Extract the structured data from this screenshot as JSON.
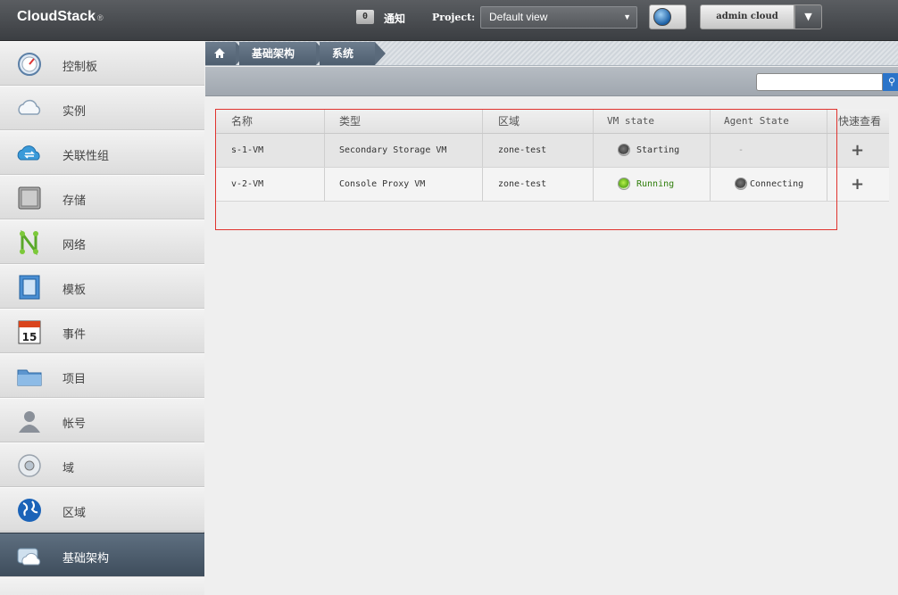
{
  "header": {
    "logo": "CloudStack",
    "logo_mark": "®",
    "notification_count": "0",
    "notification_label": "通知",
    "project_label": "Project:",
    "project_value": "Default view",
    "user_label": "admin cloud"
  },
  "sidebar": {
    "items": [
      {
        "label": "控制板",
        "icon": "dashboard-icon"
      },
      {
        "label": "实例",
        "icon": "cloud-icon"
      },
      {
        "label": "关联性组",
        "icon": "affinity-cloud-icon"
      },
      {
        "label": "存储",
        "icon": "storage-icon"
      },
      {
        "label": "网络",
        "icon": "network-icon"
      },
      {
        "label": "模板",
        "icon": "template-icon"
      },
      {
        "label": "事件",
        "icon": "calendar-icon"
      },
      {
        "label": "项目",
        "icon": "folder-icon"
      },
      {
        "label": "帐号",
        "icon": "user-icon"
      },
      {
        "label": "域",
        "icon": "domain-icon"
      },
      {
        "label": "区域",
        "icon": "globe-icon"
      },
      {
        "label": "基础架构",
        "icon": "infrastructure-icon"
      }
    ],
    "calendar_day": "15"
  },
  "breadcrumb": {
    "home_icon": "home-icon",
    "infra": "基础架构",
    "sysvm": "系统 VM"
  },
  "search": {
    "placeholder": ""
  },
  "grid": {
    "columns": [
      "名称",
      "类型",
      "区域",
      "VM state",
      "Agent State",
      "快速查看"
    ],
    "rows": [
      {
        "name": "s-1-VM",
        "type": "Secondary Storage VM",
        "zone": "zone-test",
        "vm_state": "Starting",
        "agent_state": "-"
      },
      {
        "name": "v-2-VM",
        "type": "Console Proxy VM",
        "zone": "zone-test",
        "vm_state": "Running",
        "agent_state": "Connecting"
      }
    ]
  },
  "colors": {
    "highlight_border": "#e0332e",
    "running_text": "#2e7d0a",
    "active_nav": "#4e5e6f"
  }
}
